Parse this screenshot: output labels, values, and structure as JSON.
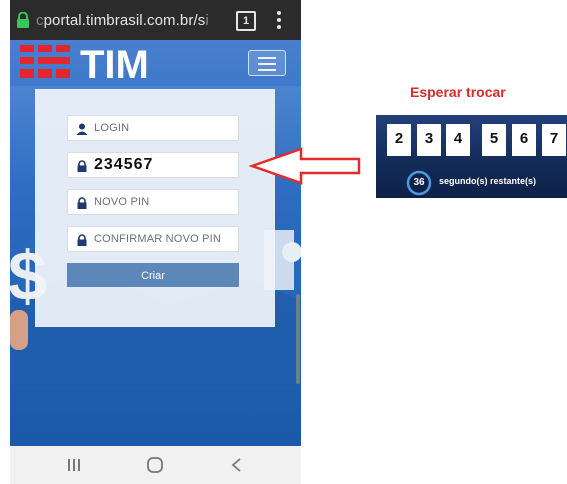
{
  "browser": {
    "url_fade": "c",
    "url_text": "portal.timbrasil.com.br/s",
    "url_dim": "i",
    "tab_count": "1"
  },
  "site": {
    "brand": "TIM"
  },
  "form": {
    "login_placeholder": "LOGIN",
    "pin_value": "234567",
    "novo_pin_placeholder": "NOVO PIN",
    "confirmar_placeholder": "CONFIRMAR NOVO PIN",
    "submit_label": "Criar"
  },
  "annotation": {
    "label": "Esperar trocar"
  },
  "pin_panel": {
    "digits": [
      "2",
      "3",
      "4",
      "5",
      "6",
      "7"
    ],
    "seconds": "36",
    "remaining_text": "segundo(s) restante(s)"
  },
  "colors": {
    "brand_red": "#e3262e",
    "annotation_red": "#d62b2b",
    "button_blue": "#5d87b8"
  }
}
